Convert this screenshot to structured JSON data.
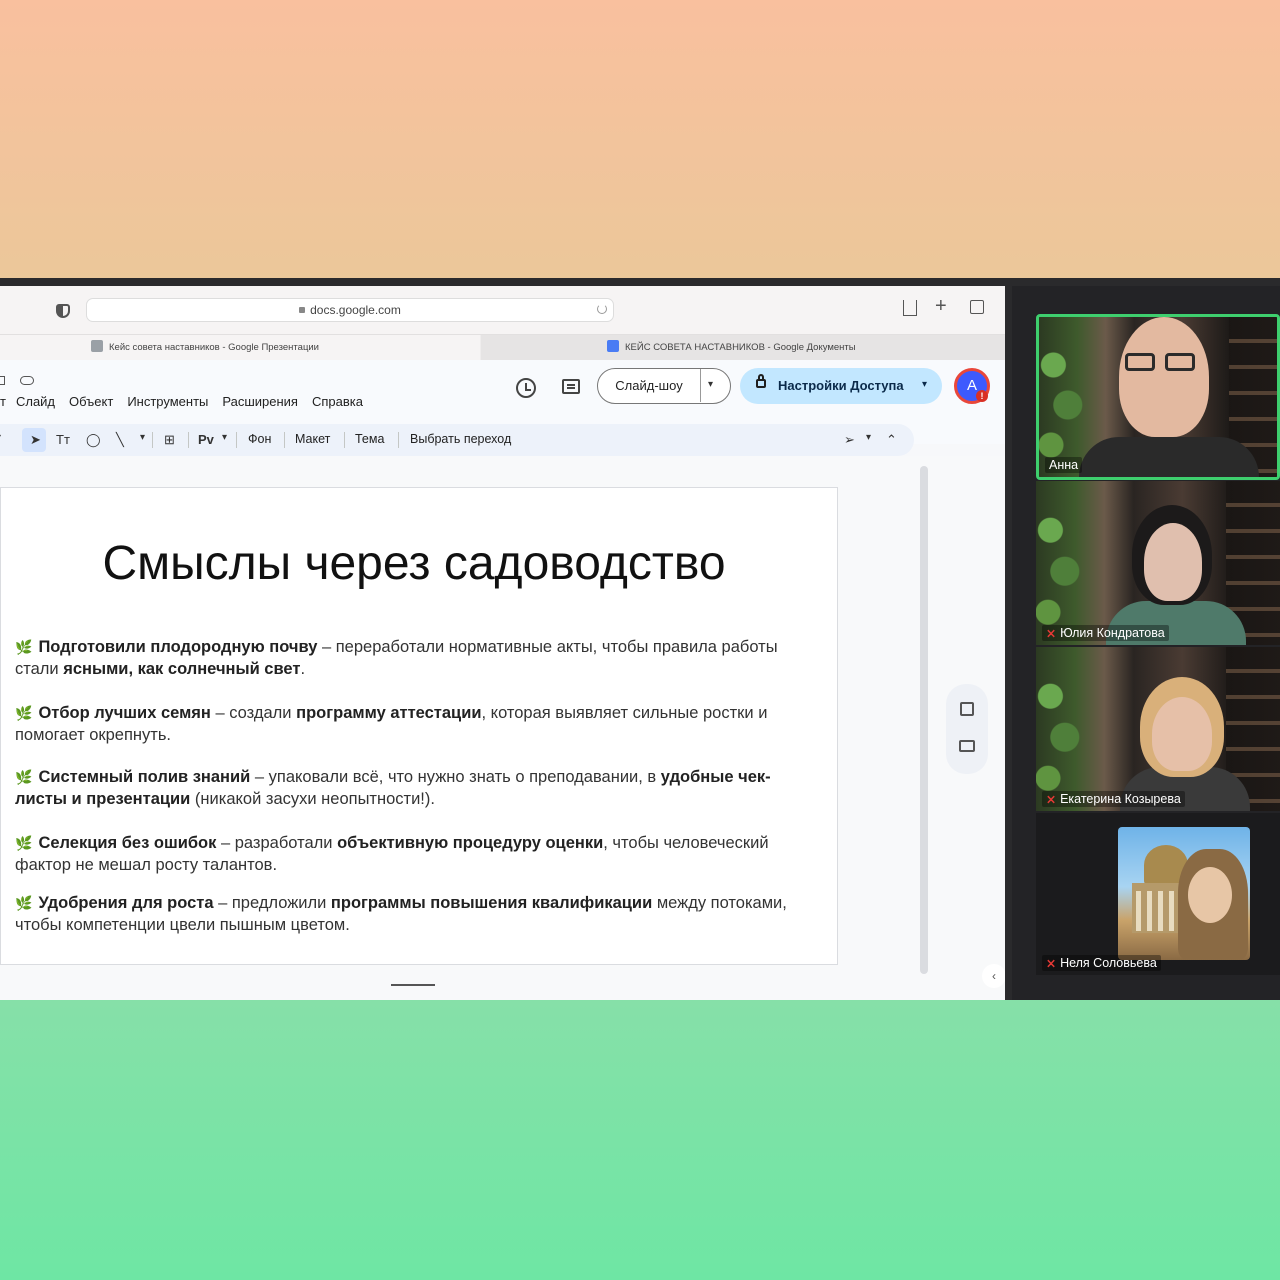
{
  "browser": {
    "url": "docs.google.com",
    "tabs": [
      {
        "label": "Кейс совета наставников - Google Презентации"
      },
      {
        "label": "КЕЙС СОВЕТА НАСТАВНИКОВ - Google Документы"
      }
    ]
  },
  "app": {
    "menu_cut": "т",
    "menu": [
      "Слайд",
      "Объект",
      "Инструменты",
      "Расширения",
      "Справка"
    ],
    "slideshow_label": "Слайд-шоу",
    "share_label": "Настройки Доступа",
    "avatar_letter": "A",
    "avatar_badge": "!",
    "toolbar": {
      "text_tool": "Tт",
      "pv": "Pv",
      "background": "Фон",
      "layout": "Макет",
      "theme": "Тема",
      "transition": "Выбрать переход"
    }
  },
  "slide": {
    "title": "Смыслы через садоводство",
    "bullets": [
      {
        "bold": "Подготовили плодородную почву",
        "text1": " – переработали нормативные акты, чтобы правила работы стали ",
        "bold2": "ясными, как солнечный свет",
        "text2": "."
      },
      {
        "bold": "Отбор лучших семян",
        "text1": " – создали ",
        "bold2": "программу аттестации",
        "text2": ", которая выявляет сильные ростки и помогает окрепнуть."
      },
      {
        "bold": "Системный полив знаний",
        "text1": " – упаковали всё, что нужно знать о преподавании, в ",
        "bold2": "удобные чек-листы и презентации",
        "text2": " (никакой засухи неопытности!)."
      },
      {
        "bold": "Селекция без ошибок",
        "text1": " – разработали ",
        "bold2": "объективную процедуру оценки",
        "text2": ", чтобы человеческий фактор не мешал росту талантов."
      },
      {
        "bold": "Удобрения для роста",
        "text1": " – предложили ",
        "bold2": "программы повышения квалификации",
        "text2": " между потоками, чтобы компетенции цвели пышным цветом."
      }
    ]
  },
  "participants": [
    {
      "name": "Анна",
      "muted": false,
      "active": true
    },
    {
      "name": "Юлия Кондратова",
      "muted": true,
      "active": false
    },
    {
      "name": "Екатерина Козырева",
      "muted": true,
      "active": false
    },
    {
      "name": "Неля Соловьева",
      "muted": true,
      "active": false
    }
  ],
  "icons": {
    "leaf": "🌿",
    "chevron_down": "▾",
    "chevron_left": "‹",
    "chevron_up": "⌃",
    "mic_off": "⨯"
  },
  "colors": {
    "active_speaker": "#3ecf6e",
    "share_button": "#c2e7ff",
    "accent_blue": "#3d5afe"
  }
}
